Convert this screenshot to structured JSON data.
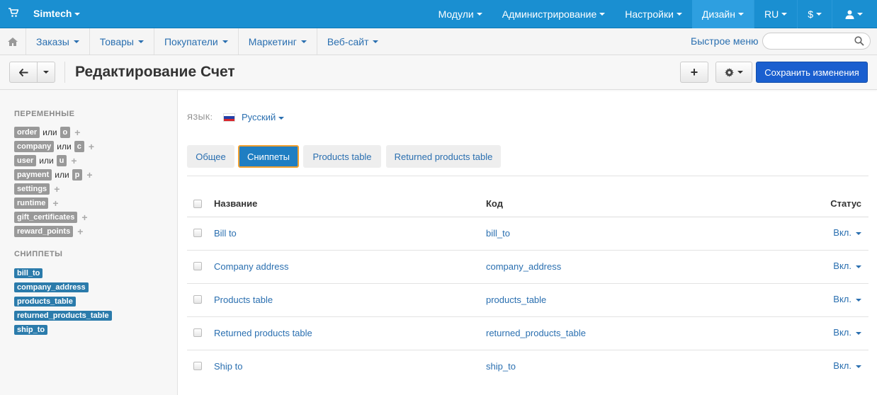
{
  "topbar": {
    "brand": "Simtech",
    "menu": [
      "Модули",
      "Администрирование",
      "Настройки",
      "Дизайн",
      "RU",
      "$"
    ]
  },
  "navbar": {
    "items": [
      "Заказы",
      "Товары",
      "Покупатели",
      "Маркетинг",
      "Веб-сайт"
    ],
    "quick_menu": "Быстрое меню",
    "search_placeholder": ""
  },
  "toolbar": {
    "title": "Редактирование Счет",
    "plus_label": "+",
    "save_label": "Сохранить изменения"
  },
  "sidebar": {
    "variables_title": "ПЕРЕМЕННЫЕ",
    "or_word": "или",
    "variables": [
      {
        "name": "order",
        "alias": "o"
      },
      {
        "name": "company",
        "alias": "c"
      },
      {
        "name": "user",
        "alias": "u"
      },
      {
        "name": "payment",
        "alias": "p"
      },
      {
        "name": "settings",
        "alias": ""
      },
      {
        "name": "runtime",
        "alias": ""
      },
      {
        "name": "gift_certificates",
        "alias": ""
      },
      {
        "name": "reward_points",
        "alias": ""
      }
    ],
    "snippets_title": "СНИППЕТЫ",
    "snippets": [
      "bill_to",
      "company_address",
      "products_table",
      "returned_products_table",
      "ship_to"
    ]
  },
  "language": {
    "label": "ЯЗЫК:",
    "value": "Русский"
  },
  "tabs": [
    "Общее",
    "Сниппеты",
    "Products table",
    "Returned products table"
  ],
  "active_tab": "Сниппеты",
  "table": {
    "headers": {
      "name": "Название",
      "code": "Код",
      "status": "Статус"
    },
    "rows": [
      {
        "name": "Bill to",
        "code": "bill_to",
        "status": "Вкл."
      },
      {
        "name": "Company address",
        "code": "company_address",
        "status": "Вкл."
      },
      {
        "name": "Products table",
        "code": "products_table",
        "status": "Вкл."
      },
      {
        "name": "Returned products table",
        "code": "returned_products_table",
        "status": "Вкл."
      },
      {
        "name": "Ship to",
        "code": "ship_to",
        "status": "Вкл."
      }
    ]
  },
  "colors": {
    "topbar": "#1a8fd1",
    "primary_button": "#1a5fcf",
    "link": "#2a6fb0",
    "active_tab": "#1f7ec2",
    "snippet_tag": "#2b7bab",
    "variable_tag": "#999999"
  }
}
